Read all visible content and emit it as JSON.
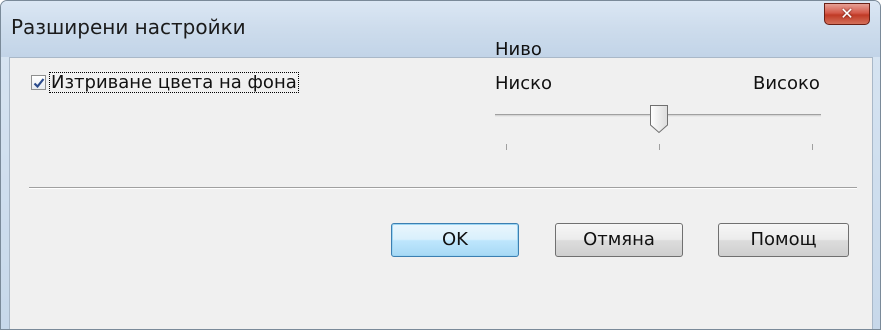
{
  "dialog": {
    "title": "Разширени настройки",
    "close_icon": "close-icon",
    "accent_close": "#c7412c"
  },
  "options": {
    "remove_bg_label": "Изтриване цвета на фона",
    "remove_bg_checked": true
  },
  "level": {
    "title": "Ниво",
    "low_label": "Ниско",
    "high_label": "Високо",
    "slider_value": 2,
    "slider_min": 1,
    "slider_max": 3
  },
  "buttons": {
    "ok": "OK",
    "cancel": "Отмяна",
    "help": "Помощ"
  }
}
